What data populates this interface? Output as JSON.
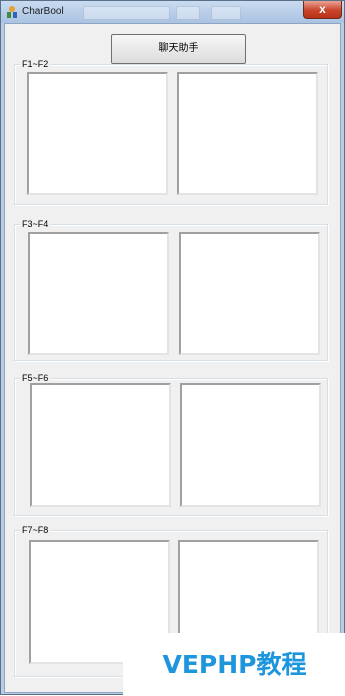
{
  "window": {
    "title": "CharBool",
    "close_label": "x"
  },
  "toolbar": {
    "chat_button_label": "聊天助手"
  },
  "groups": [
    {
      "label": "F1~F2"
    },
    {
      "label": "F3~F4"
    },
    {
      "label": "F5~F6"
    },
    {
      "label": "F7~F8"
    }
  ],
  "watermark": {
    "text": "VEPHP教程"
  }
}
